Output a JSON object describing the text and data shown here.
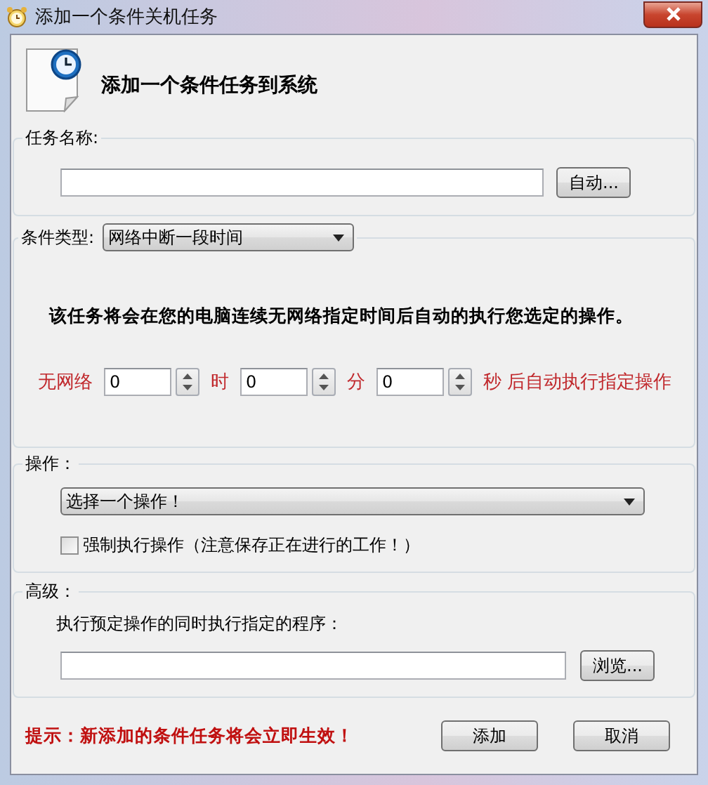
{
  "window": {
    "title": "添加一个条件关机任务"
  },
  "header": {
    "heading": "添加一个条件任务到系统"
  },
  "task_name": {
    "label": "任务名称:",
    "auto_button": "自动..."
  },
  "condition": {
    "label": "条件类型:",
    "type": "网络中断一段时间",
    "description": "该任务将会在您的电脑连续无网络指定时间后自动的执行您选定的操作。",
    "prefix": "无网络",
    "durations": [
      {
        "value": "0",
        "unit": "时"
      },
      {
        "value": "0",
        "unit": "分"
      },
      {
        "value": "0",
        "unit": "秒"
      }
    ],
    "suffix": "后自动执行指定操作"
  },
  "action": {
    "label": "操作：",
    "selection": "选择一个操作！",
    "force": {
      "label": "强制执行操作（注意保存正在进行的工作！）",
      "checked": false
    }
  },
  "advanced": {
    "label": "高级：",
    "program_label": "执行预定操作的同时执行指定的程序：",
    "browse_button": "浏览..."
  },
  "footer": {
    "tip": "提示：新添加的条件任务将会立即生效！",
    "buttons": [
      "添加",
      "取消"
    ]
  }
}
